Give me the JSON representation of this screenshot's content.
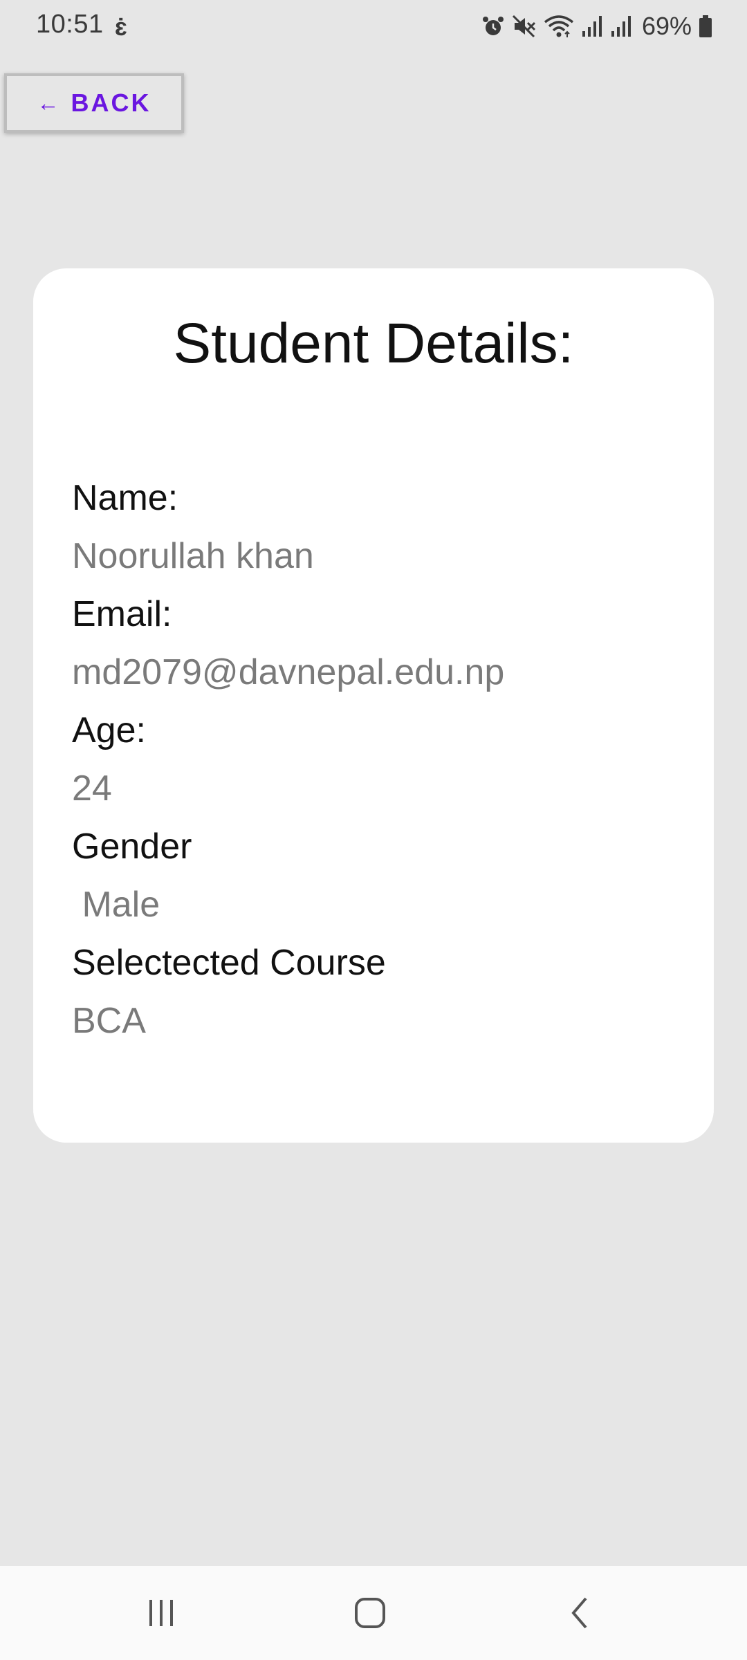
{
  "status_bar": {
    "time": "10:51",
    "app_icon_glyph": "ɛ̇",
    "battery": "69%",
    "icons": [
      "alarm-icon",
      "mute-icon",
      "wifi-icon",
      "signal-icon",
      "signal-icon",
      "battery-icon"
    ]
  },
  "back_button": {
    "arrow": "←",
    "label": "BACK",
    "color": "#6a16e0"
  },
  "card": {
    "title": "Student Details:",
    "fields": [
      {
        "label": "Name:",
        "value": "Noorullah khan"
      },
      {
        "label": "Email:",
        "value": "md2079@davnepal.edu.np"
      },
      {
        "label": "Age:",
        "value": "24"
      },
      {
        "label": "Gender",
        "value": " Male"
      },
      {
        "label": "Selectected Course",
        "value": "BCA"
      }
    ]
  },
  "nav_bar": {
    "buttons": [
      "recent-apps-icon",
      "home-icon",
      "back-icon"
    ]
  }
}
